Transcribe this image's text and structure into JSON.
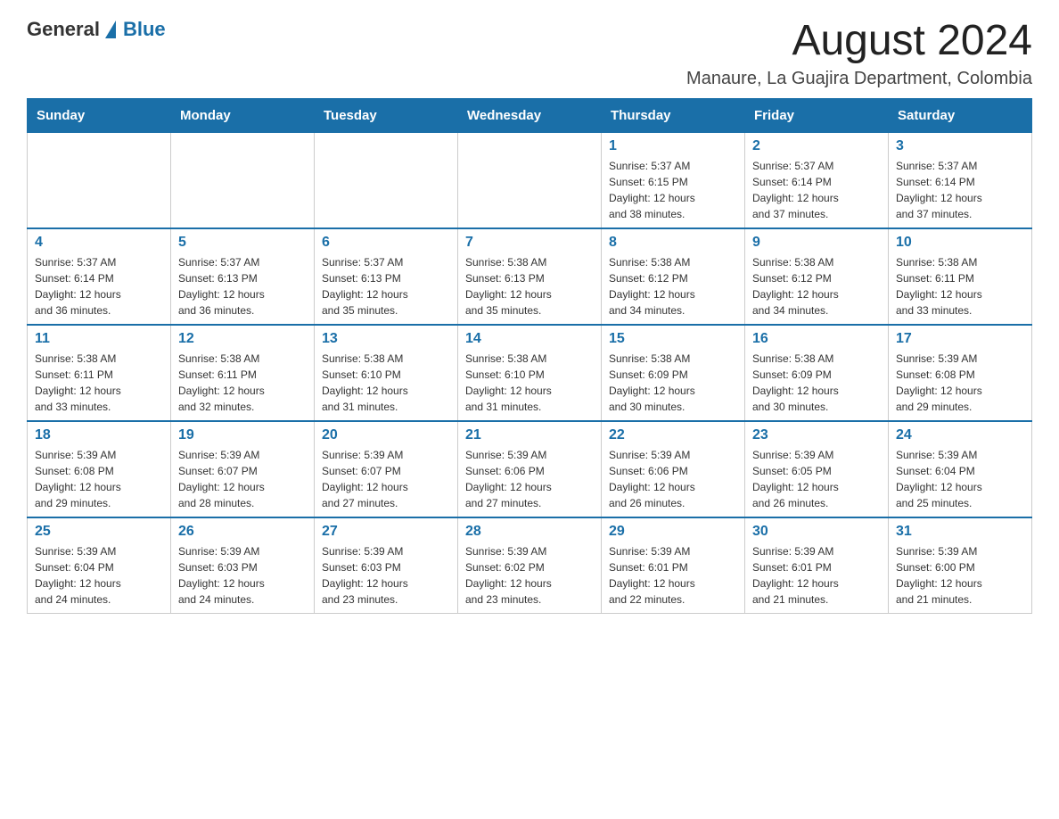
{
  "header": {
    "logo_text_general": "General",
    "logo_text_blue": "Blue",
    "month_title": "August 2024",
    "location": "Manaure, La Guajira Department, Colombia"
  },
  "days_of_week": [
    "Sunday",
    "Monday",
    "Tuesday",
    "Wednesday",
    "Thursday",
    "Friday",
    "Saturday"
  ],
  "weeks": [
    [
      {
        "day": "",
        "info": ""
      },
      {
        "day": "",
        "info": ""
      },
      {
        "day": "",
        "info": ""
      },
      {
        "day": "",
        "info": ""
      },
      {
        "day": "1",
        "info": "Sunrise: 5:37 AM\nSunset: 6:15 PM\nDaylight: 12 hours\nand 38 minutes."
      },
      {
        "day": "2",
        "info": "Sunrise: 5:37 AM\nSunset: 6:14 PM\nDaylight: 12 hours\nand 37 minutes."
      },
      {
        "day": "3",
        "info": "Sunrise: 5:37 AM\nSunset: 6:14 PM\nDaylight: 12 hours\nand 37 minutes."
      }
    ],
    [
      {
        "day": "4",
        "info": "Sunrise: 5:37 AM\nSunset: 6:14 PM\nDaylight: 12 hours\nand 36 minutes."
      },
      {
        "day": "5",
        "info": "Sunrise: 5:37 AM\nSunset: 6:13 PM\nDaylight: 12 hours\nand 36 minutes."
      },
      {
        "day": "6",
        "info": "Sunrise: 5:37 AM\nSunset: 6:13 PM\nDaylight: 12 hours\nand 35 minutes."
      },
      {
        "day": "7",
        "info": "Sunrise: 5:38 AM\nSunset: 6:13 PM\nDaylight: 12 hours\nand 35 minutes."
      },
      {
        "day": "8",
        "info": "Sunrise: 5:38 AM\nSunset: 6:12 PM\nDaylight: 12 hours\nand 34 minutes."
      },
      {
        "day": "9",
        "info": "Sunrise: 5:38 AM\nSunset: 6:12 PM\nDaylight: 12 hours\nand 34 minutes."
      },
      {
        "day": "10",
        "info": "Sunrise: 5:38 AM\nSunset: 6:11 PM\nDaylight: 12 hours\nand 33 minutes."
      }
    ],
    [
      {
        "day": "11",
        "info": "Sunrise: 5:38 AM\nSunset: 6:11 PM\nDaylight: 12 hours\nand 33 minutes."
      },
      {
        "day": "12",
        "info": "Sunrise: 5:38 AM\nSunset: 6:11 PM\nDaylight: 12 hours\nand 32 minutes."
      },
      {
        "day": "13",
        "info": "Sunrise: 5:38 AM\nSunset: 6:10 PM\nDaylight: 12 hours\nand 31 minutes."
      },
      {
        "day": "14",
        "info": "Sunrise: 5:38 AM\nSunset: 6:10 PM\nDaylight: 12 hours\nand 31 minutes."
      },
      {
        "day": "15",
        "info": "Sunrise: 5:38 AM\nSunset: 6:09 PM\nDaylight: 12 hours\nand 30 minutes."
      },
      {
        "day": "16",
        "info": "Sunrise: 5:38 AM\nSunset: 6:09 PM\nDaylight: 12 hours\nand 30 minutes."
      },
      {
        "day": "17",
        "info": "Sunrise: 5:39 AM\nSunset: 6:08 PM\nDaylight: 12 hours\nand 29 minutes."
      }
    ],
    [
      {
        "day": "18",
        "info": "Sunrise: 5:39 AM\nSunset: 6:08 PM\nDaylight: 12 hours\nand 29 minutes."
      },
      {
        "day": "19",
        "info": "Sunrise: 5:39 AM\nSunset: 6:07 PM\nDaylight: 12 hours\nand 28 minutes."
      },
      {
        "day": "20",
        "info": "Sunrise: 5:39 AM\nSunset: 6:07 PM\nDaylight: 12 hours\nand 27 minutes."
      },
      {
        "day": "21",
        "info": "Sunrise: 5:39 AM\nSunset: 6:06 PM\nDaylight: 12 hours\nand 27 minutes."
      },
      {
        "day": "22",
        "info": "Sunrise: 5:39 AM\nSunset: 6:06 PM\nDaylight: 12 hours\nand 26 minutes."
      },
      {
        "day": "23",
        "info": "Sunrise: 5:39 AM\nSunset: 6:05 PM\nDaylight: 12 hours\nand 26 minutes."
      },
      {
        "day": "24",
        "info": "Sunrise: 5:39 AM\nSunset: 6:04 PM\nDaylight: 12 hours\nand 25 minutes."
      }
    ],
    [
      {
        "day": "25",
        "info": "Sunrise: 5:39 AM\nSunset: 6:04 PM\nDaylight: 12 hours\nand 24 minutes."
      },
      {
        "day": "26",
        "info": "Sunrise: 5:39 AM\nSunset: 6:03 PM\nDaylight: 12 hours\nand 24 minutes."
      },
      {
        "day": "27",
        "info": "Sunrise: 5:39 AM\nSunset: 6:03 PM\nDaylight: 12 hours\nand 23 minutes."
      },
      {
        "day": "28",
        "info": "Sunrise: 5:39 AM\nSunset: 6:02 PM\nDaylight: 12 hours\nand 23 minutes."
      },
      {
        "day": "29",
        "info": "Sunrise: 5:39 AM\nSunset: 6:01 PM\nDaylight: 12 hours\nand 22 minutes."
      },
      {
        "day": "30",
        "info": "Sunrise: 5:39 AM\nSunset: 6:01 PM\nDaylight: 12 hours\nand 21 minutes."
      },
      {
        "day": "31",
        "info": "Sunrise: 5:39 AM\nSunset: 6:00 PM\nDaylight: 12 hours\nand 21 minutes."
      }
    ]
  ]
}
